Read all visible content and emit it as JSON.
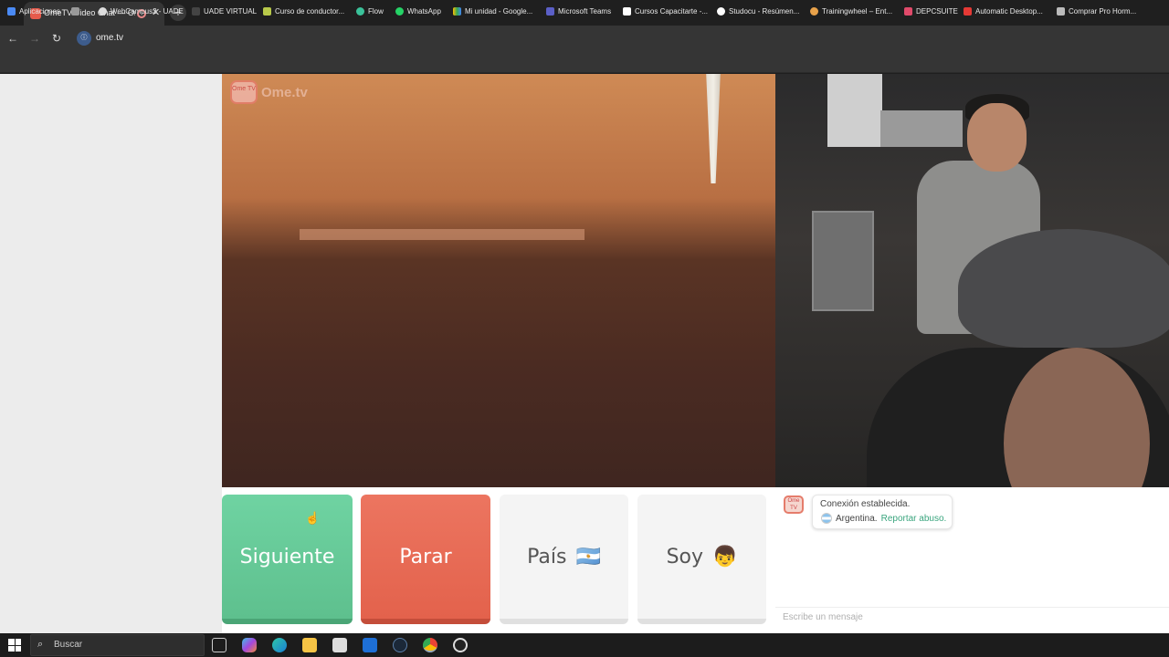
{
  "browser": {
    "tab_title": "OmeTV Video Chat — Ome",
    "url": "ome.tv",
    "bookmarks": [
      "Aplicaciones",
      "WebCampus2 - UADE",
      "UADE VIRTUAL",
      "Curso de conductor...",
      "Flow",
      "WhatsApp",
      "Mi unidad - Google...",
      "Microsoft Teams",
      "Cursos Capacitarte -...",
      "Studocu - Resúmen...",
      "Trainingwheel – Ent...",
      "DEPCSUITE",
      "Automatic Desktop...",
      "Comprar Pro Horm..."
    ]
  },
  "logo": {
    "text": "Ome.tv",
    "badge": "Ome TV"
  },
  "controls": {
    "next_label": "Siguiente",
    "stop_label": "Parar",
    "country_label": "País",
    "country_emoji": "🇦🇷",
    "gender_label": "Soy",
    "gender_emoji": "👦"
  },
  "chat": {
    "status": "Conexión establecida.",
    "country": "Argentina.",
    "report_link": "Reportar abuso.",
    "input_placeholder": "Escribe un mensaje"
  },
  "taskbar": {
    "search_placeholder": "Buscar"
  },
  "colors": {
    "next": "#5ec08e",
    "stop": "#e3624c",
    "link": "#3aa57e"
  }
}
